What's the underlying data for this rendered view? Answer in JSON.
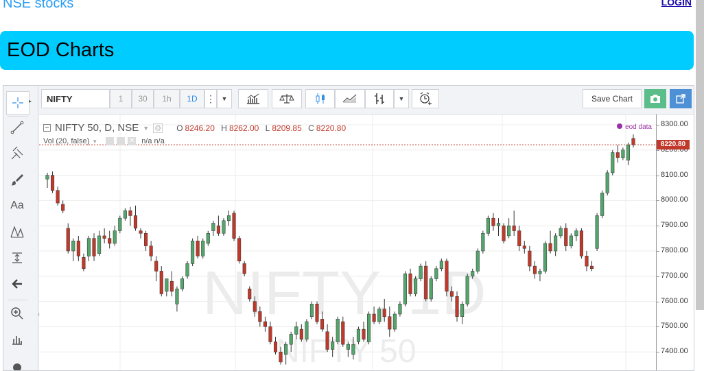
{
  "page": {
    "site_title": "NSE stocks",
    "login": "LOGIN"
  },
  "banner": {
    "title": "EOD Charts"
  },
  "toolbar": {
    "symbol": "NIFTY",
    "intervals": [
      "1",
      "30",
      "1h",
      "1D"
    ],
    "active_interval": "1D",
    "save_label": "Save Chart"
  },
  "legend": {
    "title": "NIFTY 50, D, NSE",
    "o_label": "O",
    "o": "8246.20",
    "h_label": "H",
    "h": "8262.00",
    "l_label": "L",
    "l": "8209.85",
    "c_label": "C",
    "c": "8220.80",
    "vol": "Vol (20, false)",
    "vol_values": "n/a n/a",
    "source": "eod data"
  },
  "watermark": {
    "big": "NIFTY, 1D",
    "small": "NIFTY 50"
  },
  "colors": {
    "up": "#53a56b",
    "down": "#c0392b",
    "accent": "#00ccff",
    "link": "#2a9df4"
  },
  "chart_data": {
    "type": "candlestick",
    "symbol": "NIFTY 50",
    "interval": "D",
    "exchange": "NSE",
    "y_ticks": [
      8300,
      8200,
      8100,
      8000,
      7900,
      7800,
      7700,
      7600,
      7500,
      7400
    ],
    "y_tick_labels": [
      "8300.00",
      "8200.00",
      "8100.00",
      "8000.00",
      "7900.00",
      "7800.00",
      "7700.00",
      "7600.00",
      "7500.00",
      "7400.00"
    ],
    "last_price": 8220.8,
    "last_price_label": "8220.80",
    "ylim": [
      7350,
      8340
    ],
    "grid": true,
    "candles": [
      [
        8085,
        8110,
        8050,
        8100
      ],
      [
        8100,
        8115,
        8030,
        8040
      ],
      [
        8040,
        8055,
        7980,
        7990
      ],
      [
        7985,
        8000,
        7950,
        7960
      ],
      [
        7890,
        7910,
        7790,
        7800
      ],
      [
        7800,
        7850,
        7760,
        7840
      ],
      [
        7840,
        7860,
        7760,
        7780
      ],
      [
        7775,
        7790,
        7720,
        7730
      ],
      [
        7780,
        7860,
        7760,
        7850
      ],
      [
        7850,
        7870,
        7760,
        7780
      ],
      [
        7790,
        7880,
        7780,
        7860
      ],
      [
        7860,
        7890,
        7830,
        7850
      ],
      [
        7850,
        7880,
        7810,
        7830
      ],
      [
        7830,
        7900,
        7820,
        7880
      ],
      [
        7880,
        7940,
        7870,
        7930
      ],
      [
        7930,
        7970,
        7920,
        7960
      ],
      [
        7960,
        7975,
        7900,
        7940
      ],
      [
        7940,
        7980,
        7880,
        7890
      ],
      [
        7880,
        7890,
        7850,
        7870
      ],
      [
        7870,
        7880,
        7800,
        7820
      ],
      [
        7820,
        7840,
        7760,
        7780
      ],
      [
        7760,
        7780,
        7680,
        7720
      ],
      [
        7720,
        7740,
        7620,
        7630
      ],
      [
        7640,
        7680,
        7620,
        7690
      ],
      [
        7680,
        7720,
        7620,
        7640
      ],
      [
        7590,
        7660,
        7560,
        7650
      ],
      [
        7650,
        7700,
        7640,
        7690
      ],
      [
        7700,
        7760,
        7690,
        7750
      ],
      [
        7750,
        7850,
        7740,
        7840
      ],
      [
        7840,
        7860,
        7770,
        7780
      ],
      [
        7780,
        7850,
        7770,
        7840
      ],
      [
        7830,
        7880,
        7820,
        7870
      ],
      [
        7880,
        7920,
        7860,
        7910
      ],
      [
        7900,
        7940,
        7860,
        7870
      ],
      [
        7870,
        7930,
        7860,
        7920
      ],
      [
        7920,
        7960,
        7900,
        7940
      ],
      [
        7950,
        7960,
        7840,
        7850
      ],
      [
        7850,
        7860,
        7750,
        7760
      ],
      [
        7750,
        7760,
        7700,
        7710
      ],
      [
        7650,
        7660,
        7600,
        7610
      ],
      [
        7600,
        7620,
        7540,
        7560
      ],
      [
        7560,
        7580,
        7500,
        7520
      ],
      [
        7520,
        7540,
        7480,
        7500
      ],
      [
        7500,
        7520,
        7430,
        7440
      ],
      [
        7440,
        7460,
        7390,
        7400
      ],
      [
        7400,
        7420,
        7350,
        7360
      ],
      [
        7390,
        7440,
        7350,
        7430
      ],
      [
        7430,
        7480,
        7400,
        7470
      ],
      [
        7470,
        7520,
        7450,
        7500
      ],
      [
        7490,
        7510,
        7440,
        7450
      ],
      [
        7450,
        7530,
        7440,
        7520
      ],
      [
        7540,
        7600,
        7530,
        7590
      ],
      [
        7590,
        7600,
        7510,
        7520
      ],
      [
        7530,
        7560,
        7480,
        7490
      ],
      [
        7480,
        7510,
        7400,
        7410
      ],
      [
        7410,
        7460,
        7380,
        7440
      ],
      [
        7440,
        7540,
        7430,
        7530
      ],
      [
        7520,
        7540,
        7420,
        7430
      ],
      [
        7410,
        7440,
        7380,
        7430
      ],
      [
        7390,
        7460,
        7370,
        7430
      ],
      [
        7440,
        7500,
        7430,
        7490
      ],
      [
        7490,
        7520,
        7440,
        7450
      ],
      [
        7440,
        7560,
        7430,
        7550
      ],
      [
        7550,
        7580,
        7510,
        7520
      ],
      [
        7520,
        7580,
        7510,
        7570
      ],
      [
        7570,
        7610,
        7520,
        7540
      ],
      [
        7540,
        7580,
        7460,
        7490
      ],
      [
        7490,
        7560,
        7480,
        7550
      ],
      [
        7550,
        7600,
        7540,
        7590
      ],
      [
        7590,
        7720,
        7580,
        7710
      ],
      [
        7710,
        7730,
        7620,
        7630
      ],
      [
        7630,
        7700,
        7620,
        7690
      ],
      [
        7690,
        7750,
        7680,
        7740
      ],
      [
        7740,
        7760,
        7600,
        7610
      ],
      [
        7610,
        7700,
        7600,
        7690
      ],
      [
        7690,
        7740,
        7680,
        7730
      ],
      [
        7730,
        7770,
        7720,
        7760
      ],
      [
        7760,
        7770,
        7620,
        7640
      ],
      [
        7640,
        7660,
        7600,
        7620
      ],
      [
        7620,
        7640,
        7520,
        7540
      ],
      [
        7540,
        7600,
        7510,
        7590
      ],
      [
        7590,
        7710,
        7580,
        7700
      ],
      [
        7700,
        7730,
        7690,
        7720
      ],
      [
        7720,
        7810,
        7710,
        7800
      ],
      [
        7800,
        7880,
        7790,
        7870
      ],
      [
        7870,
        7940,
        7860,
        7930
      ],
      [
        7930,
        7950,
        7880,
        7900
      ],
      [
        7900,
        7930,
        7860,
        7910
      ],
      [
        7900,
        7910,
        7830,
        7840
      ],
      [
        7860,
        7930,
        7850,
        7900
      ],
      [
        7900,
        7960,
        7860,
        7880
      ],
      [
        7880,
        7900,
        7800,
        7820
      ],
      [
        7820,
        7840,
        7790,
        7810
      ],
      [
        7800,
        7820,
        7720,
        7740
      ],
      [
        7740,
        7760,
        7690,
        7710
      ],
      [
        7710,
        7730,
        7680,
        7720
      ],
      [
        7720,
        7840,
        7710,
        7830
      ],
      [
        7830,
        7880,
        7790,
        7800
      ],
      [
        7800,
        7870,
        7780,
        7860
      ],
      [
        7860,
        7900,
        7850,
        7890
      ],
      [
        7890,
        7910,
        7800,
        7820
      ],
      [
        7820,
        7870,
        7810,
        7860
      ],
      [
        7860,
        7890,
        7840,
        7880
      ],
      [
        7880,
        7890,
        7770,
        7780
      ],
      [
        7780,
        7800,
        7720,
        7740
      ],
      [
        7740,
        7760,
        7720,
        7730
      ],
      [
        7810,
        7950,
        7800,
        7940
      ],
      [
        7940,
        8040,
        7930,
        8030
      ],
      [
        8030,
        8120,
        8020,
        8110
      ],
      [
        8110,
        8200,
        8100,
        8190
      ],
      [
        8190,
        8220,
        8150,
        8170
      ],
      [
        8170,
        8210,
        8160,
        8200
      ],
      [
        8160,
        8230,
        8140,
        8220
      ],
      [
        8246.2,
        8262,
        8209.85,
        8220.8
      ]
    ]
  }
}
